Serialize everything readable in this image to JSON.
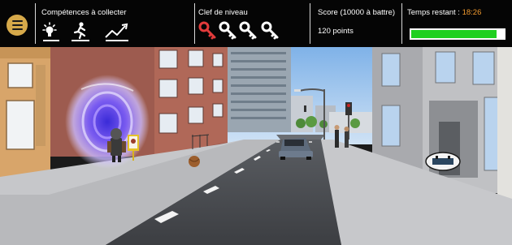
{
  "hud": {
    "menu_icon": "hamburger-menu-icon",
    "skills": {
      "label": "Compétences à collecter",
      "icons": [
        "idea-icon",
        "running-figure-icon",
        "growth-chart-icon"
      ]
    },
    "keys": {
      "label": "Clef de niveau",
      "icons": [
        "key-icon-red",
        "key-icon-white",
        "key-icon-white",
        "key-icon-white"
      ],
      "collected": 1,
      "total": 4,
      "collected_color": "#e23b3b"
    },
    "score": {
      "label": "Score (10000 à battre)",
      "value": "120 points"
    },
    "timer": {
      "label": "Temps restant : ",
      "value": "18:26",
      "value_color": "#f29a2e",
      "progress": 0.92,
      "bar_color": "#1fd01f"
    }
  },
  "scene": {
    "items": [
      "portal-icon",
      "robot-figure",
      "signpost-poster",
      "ball",
      "car",
      "pedestrians",
      "hovering-drone-icon",
      "traffic-light",
      "street-lamp"
    ]
  }
}
